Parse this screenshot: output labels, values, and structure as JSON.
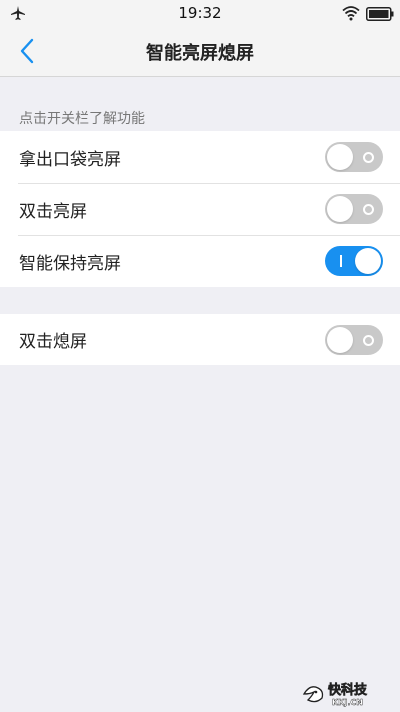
{
  "status_bar": {
    "time": "19:32"
  },
  "nav": {
    "title": "智能亮屏熄屏"
  },
  "section_caption": "点击开关栏了解功能",
  "group1": {
    "items": [
      {
        "label": "拿出口袋亮屏",
        "enabled": false
      },
      {
        "label": "双击亮屏",
        "enabled": false
      },
      {
        "label": "智能保持亮屏",
        "enabled": true
      }
    ]
  },
  "group2": {
    "items": [
      {
        "label": "双击熄屏",
        "enabled": false
      }
    ]
  },
  "watermark": {
    "brand": "快科技",
    "domain": "KKJ.CN"
  },
  "colors": {
    "accent": "#1890f0",
    "toggle_off": "#c9c9c9",
    "background": "#efeff4"
  }
}
